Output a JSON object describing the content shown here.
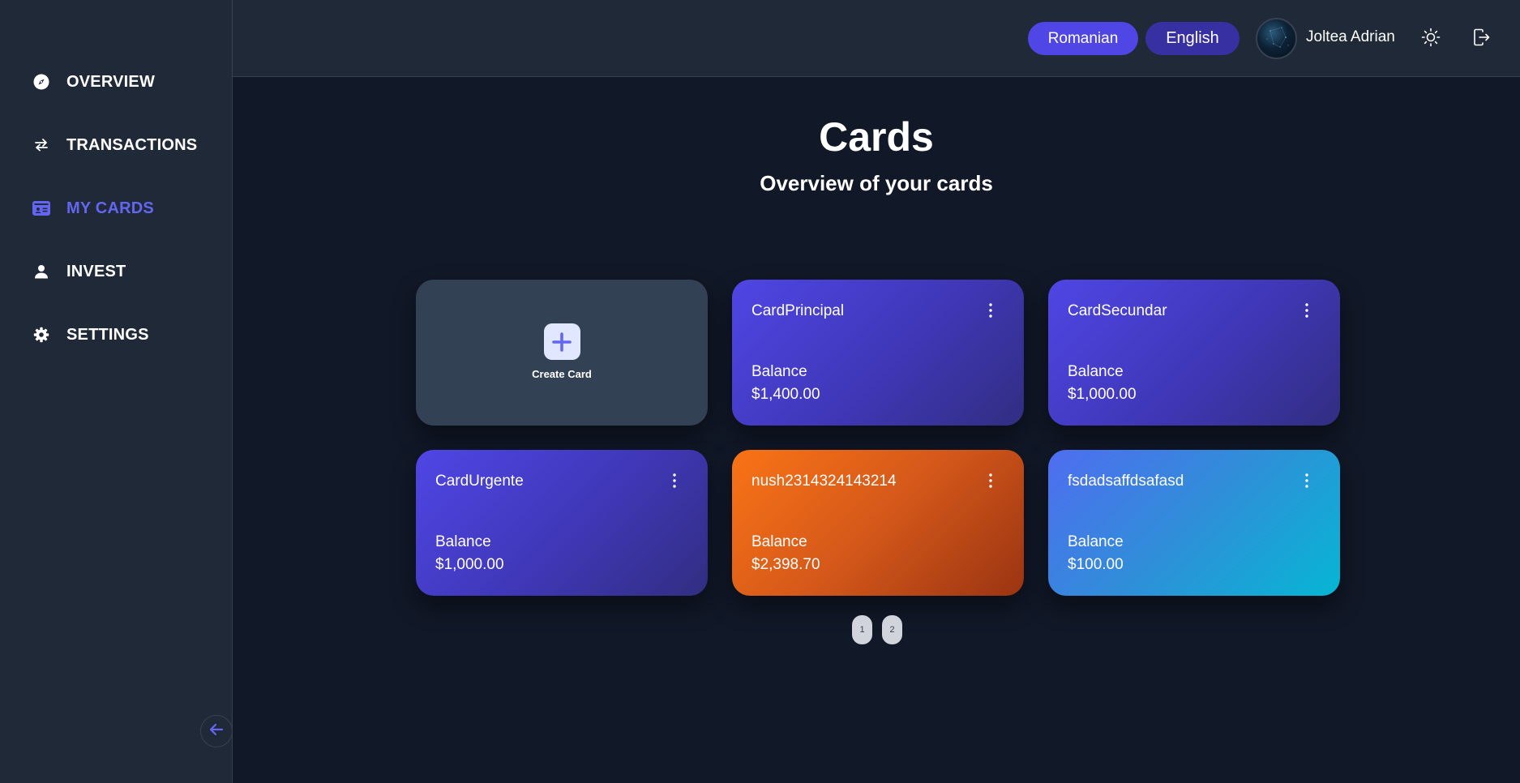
{
  "sidebar": {
    "items": [
      {
        "label": "OVERVIEW",
        "icon": "compass-icon",
        "active": false
      },
      {
        "label": "TRANSACTIONS",
        "icon": "transfer-arrows-icon",
        "active": false
      },
      {
        "label": "MY CARDS",
        "icon": "id-card-icon",
        "active": true
      },
      {
        "label": "INVEST",
        "icon": "user-icon",
        "active": false
      },
      {
        "label": "SETTINGS",
        "icon": "gear-icon",
        "active": false
      }
    ],
    "collapse_icon": "arrow-left-icon"
  },
  "header": {
    "languages": [
      "Romanian",
      "English"
    ],
    "user_name": "Joltea Adrian",
    "theme_icon": "sun-icon",
    "logout_icon": "logout-icon"
  },
  "main": {
    "title": "Cards",
    "subtitle": "Overview of your cards",
    "create_card_label": "Create Card",
    "cards": [
      {
        "name": "CardPrincipal",
        "balance_label": "Balance",
        "balance": "$1,400.00",
        "theme": "indigo"
      },
      {
        "name": "CardSecundar",
        "balance_label": "Balance",
        "balance": "$1,000.00",
        "theme": "indigo"
      },
      {
        "name": "CardUrgente",
        "balance_label": "Balance",
        "balance": "$1,000.00",
        "theme": "indigo"
      },
      {
        "name": "nush2314324143214",
        "balance_label": "Balance",
        "balance": "$2,398.70",
        "theme": "orange"
      },
      {
        "name": "fsdadsaffdsafasd",
        "balance_label": "Balance",
        "balance": "$100.00",
        "theme": "cyan"
      }
    ],
    "pagination": [
      "1",
      "2"
    ]
  },
  "colors": {
    "accent": "#6366f1",
    "sidebar_bg": "#1f2937",
    "page_bg": "#111827",
    "create_card_bg": "#334155"
  }
}
